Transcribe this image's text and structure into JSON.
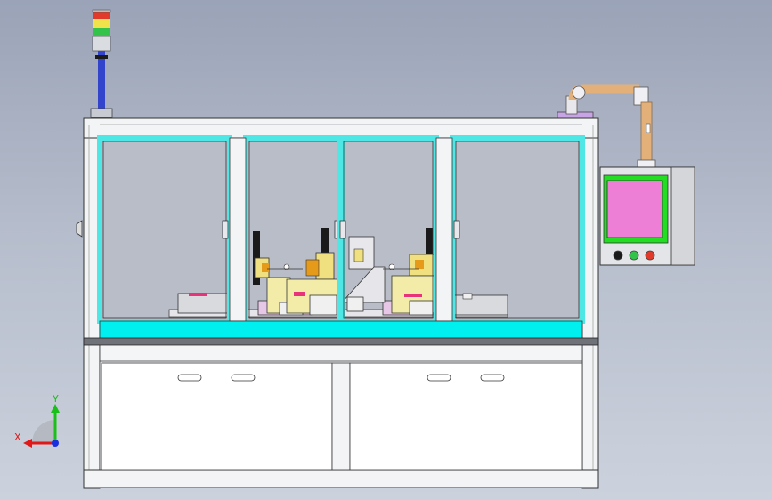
{
  "viewport": {
    "background_top": "#9aa3b7",
    "background_bottom": "#ccd2dd"
  },
  "machine": {
    "frame_color": "#f2f4f6",
    "glass_frame_color": "#4fe6e6",
    "deck_color": "#00f0f0",
    "glass_tint": "#b8bdc8"
  },
  "signal_tower": {
    "lights": [
      "red",
      "yellow",
      "green"
    ],
    "colors": [
      "#e23a2a",
      "#f0e24a",
      "#33c24a"
    ]
  },
  "control_box": {
    "screen_color": "#ee7fd7",
    "screen_border_color": "#22dd22",
    "buttons": [
      "black",
      "green",
      "red"
    ]
  },
  "cable_arm": {
    "color": "#e3b07a"
  },
  "triad": {
    "x_label": "X",
    "y_label": "Y",
    "x_color": "#e01818",
    "y_color": "#18c018",
    "z_color": "#1830e0"
  }
}
